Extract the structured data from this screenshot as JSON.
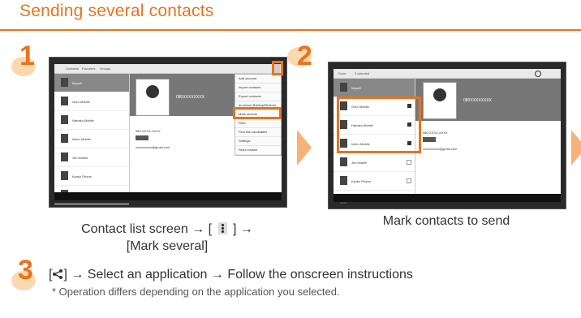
{
  "page": {
    "title": "Sending several contacts"
  },
  "steps": [
    {
      "number": "1",
      "caption_line1": "Contact list screen → [",
      "caption_mid": "] →",
      "caption_line2": "[Mark several]"
    },
    {
      "number": "2",
      "caption": "Mark contacts to send"
    },
    {
      "number": "3",
      "text_pre": "[",
      "text_post": "] → Select an application → Follow the onscreen instructions",
      "note": "* Operation differs depending on the application you selected."
    }
  ],
  "screen1": {
    "tabs": [
      "Contacts",
      "Favorites",
      "Groups"
    ],
    "contacts": [
      "Myself",
      "Goro Mobile",
      "Hanako Mobile",
      "Ichiro Mobile",
      "Jiro Mobile",
      "Kyoko Phone",
      "Saburo Mobile"
    ],
    "number": "080XXXXXXXX",
    "detail_mobile": "080-XXXX-XXXX",
    "detail_email": "xxxxxxxxxx@gmail.com",
    "menu": [
      "Add account",
      "Import contacts",
      "Export contacts",
      "au server Backup/Restore",
      "Mark several",
      "Filter",
      "Find link candidates",
      "Settings",
      "Send contact"
    ],
    "highlight_item": "Mark several"
  },
  "screen2": {
    "header_done": "Done",
    "header_count": "3 selected",
    "contacts": [
      "Myself",
      "Goro Mobile",
      "Hanako Mobile",
      "Ichiro Mobile",
      "Jiro Mobile",
      "Kyoko Phone",
      "Saburo Mobile"
    ],
    "checked": [
      false,
      true,
      true,
      true,
      false,
      false,
      false
    ],
    "number": "080XXXXXXXX",
    "detail_mobile": "080-XXXX-XXXX",
    "detail_email": "xxxxxxxxxx@gmail.com"
  },
  "colors": {
    "accent": "#e8741c",
    "arrow": "#f7b27a"
  }
}
